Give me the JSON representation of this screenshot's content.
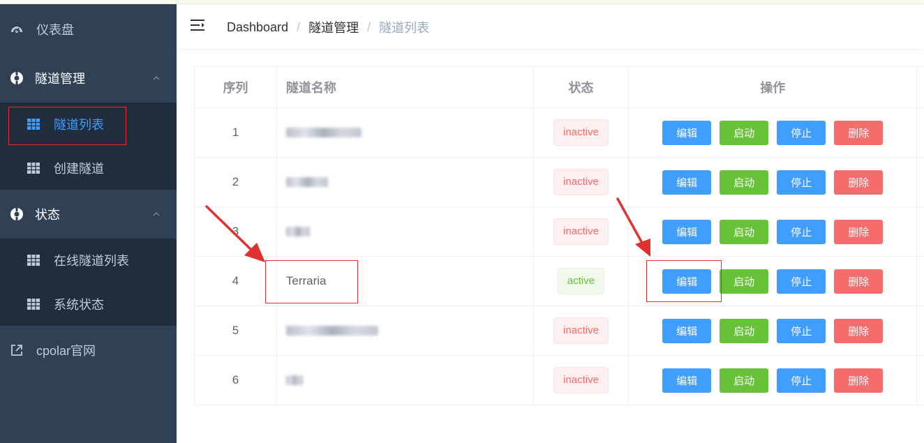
{
  "sidebar": {
    "dashboard": "仪表盘",
    "tunnel_mgmt": "隧道管理",
    "tunnel_list": "隧道列表",
    "create_tunnel": "创建隧道",
    "status": "状态",
    "online_tunnels": "在线隧道列表",
    "system_status": "系统状态",
    "cpolar_site": "cpolar官网"
  },
  "breadcrumb": [
    "Dashboard",
    "隧道管理",
    "隧道列表"
  ],
  "table": {
    "headers": [
      "序列",
      "隧道名称",
      "状态",
      "操作"
    ],
    "rows": [
      {
        "index": "1",
        "name": "",
        "status": "inactive"
      },
      {
        "index": "2",
        "name": "",
        "status": "inactive"
      },
      {
        "index": "3",
        "name": "",
        "status": "inactive"
      },
      {
        "index": "4",
        "name": "Terraria",
        "status": "active"
      },
      {
        "index": "5",
        "name": "",
        "status": "inactive"
      },
      {
        "index": "6",
        "name": "",
        "status": "inactive"
      }
    ],
    "actions": {
      "edit": "编辑",
      "start": "启动",
      "stop": "停止",
      "delete": "删除"
    }
  },
  "colors": {
    "sidebar_bg": "#304156",
    "submenu_bg": "#1f2d3d",
    "primary": "#409eff",
    "success": "#67c23a",
    "danger": "#f56c6c",
    "annotation": "#e03030"
  }
}
